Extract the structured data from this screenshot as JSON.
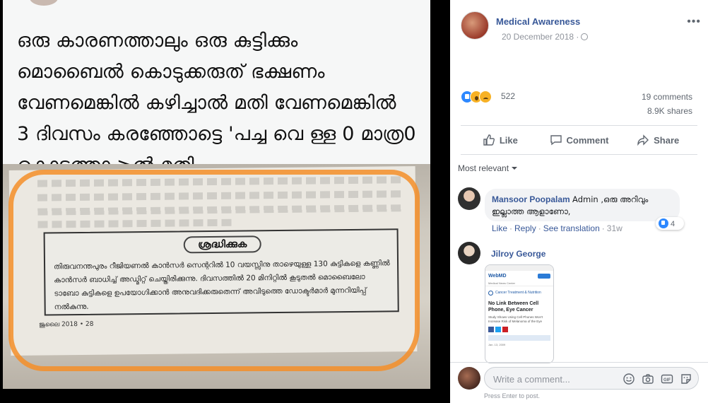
{
  "photo": {
    "caption_lines": [
      "ഒരു കാരണത്താലും ഒരു കുട്ടിക്കും",
      "മൊബൈൽ കൊടുക്കരുത്   ഭക്ഷണം",
      "വേണമെങ്കിൽ കഴിച്ചാൽ മതി വേണമെങ്കിൽ",
      "3 ദിവസം കരഞ്ഞോട്ടെ 'പച്ച വെ ള്ള 0 മാത്ര0",
      "കൊടുത്താ >ൽ മതി"
    ],
    "clipping": {
      "title": "ശ്രദ്ധിക്കുക",
      "body": "തിരുവനന്തപുരം റീജിയണൽ കാൻസർ സെന്ററിൽ 10 വയസ്സിനു താഴെയുള്ള 130 കുട്ടികളെ കണ്ണിൽ കാൻസർ ബാധിച്ച് അഡ്മിറ്റ് ചെയ്തിരിക്കുന്നു. ദിവസത്തിൽ 20 മിനിറ്റിൽ കൂടുതൽ മൊബൈലോ ടാബോ കുട്ടികളെ ഉപയോഗിക്കാൻ അനുവദിക്കരുതെന്ന് അവിടുത്തെ ഡോക്ടർമാർ മുന്നറിയിപ്പ് നൽകുന്നു.",
      "footer": "ജൂലൈ 2018 • 28"
    }
  },
  "post": {
    "page_name": "Medical Awareness",
    "date": "20 December 2018 ·",
    "more_label": "•••"
  },
  "stats": {
    "reaction_count": "522",
    "comments": "19 comments",
    "shares": "8.9K shares"
  },
  "actions": {
    "like": "Like",
    "comment": "Comment",
    "share": "Share"
  },
  "sort_label": "Most relevant",
  "comments": [
    {
      "author": "Mansoor Poopalam",
      "text": "Admin ,ഒരു അറിവും ഇല്ലാത്ത ആളാണോ,",
      "likes": "4",
      "like_label": "Like",
      "reply_label": "Reply",
      "translate_label": "See translation",
      "time": "31w"
    },
    {
      "author": "Jilroy George",
      "attachment": {
        "logo": "WebMD",
        "crumb": "Medical News Center",
        "category": "Cancer Treatment & Nutrition",
        "title": "No Link Between Cell Phone, Eye Cancer",
        "subtitle": "Study Shows Using Cell Phones Won't Increase Risk of Melanoma of the Eye",
        "date": "Jan. 13, 2009"
      }
    }
  ],
  "composer": {
    "placeholder": "Write a comment...",
    "hint": "Press Enter to post."
  },
  "colors": {
    "link_blue": "#385898",
    "like_blue": "#2d88ff",
    "highlight_orange": "#f58e28"
  }
}
